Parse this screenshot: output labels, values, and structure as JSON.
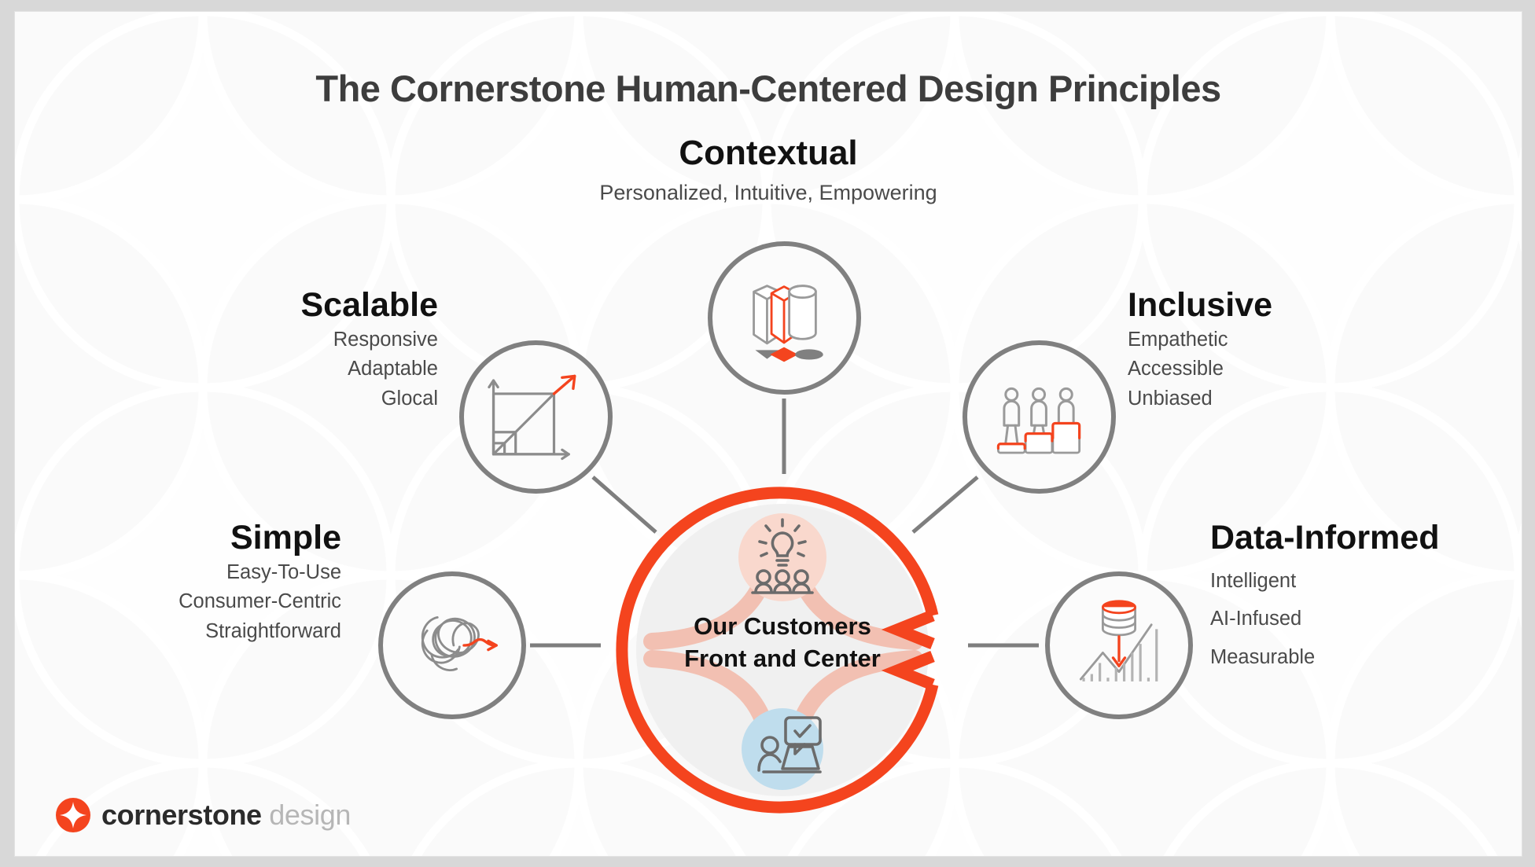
{
  "slide": {
    "title": "The Cornerstone Human-Centered Design Principles",
    "accent_color": "#f4441e",
    "circle_stroke_color": "#808080",
    "title_color": "#3d3d3d",
    "background_color": "#fafafa"
  },
  "center": {
    "line1": "Our Customers",
    "line2": "Front and Center",
    "ring_color": "#f4441e",
    "inner_color": "#f0f0f0",
    "top_icon": "lightbulb-people-icon",
    "bottom_icon": "person-laptop-check-icon",
    "connector_color": "#f2c0b2"
  },
  "principles": [
    {
      "id": "contextual",
      "heading": "Contextual",
      "attributes": [
        "Personalized, Intuitive, Empowering"
      ],
      "icon": "three-3d-shapes-icon",
      "position": "top"
    },
    {
      "id": "scalable",
      "heading": "Scalable",
      "attributes": [
        "Responsive",
        "Adaptable",
        "Glocal"
      ],
      "icon": "growth-arrow-squares-icon",
      "position": "upper-left"
    },
    {
      "id": "inclusive",
      "heading": "Inclusive",
      "attributes": [
        "Empathetic",
        "Accessible",
        "Unbiased"
      ],
      "icon": "equity-people-boxes-icon",
      "position": "upper-right"
    },
    {
      "id": "simple",
      "heading": "Simple",
      "attributes": [
        "Easy-To-Use",
        "Consumer-Centric",
        "Straightforward"
      ],
      "icon": "tangle-to-arrow-icon",
      "position": "lower-left"
    },
    {
      "id": "data-informed",
      "heading": "Data-Informed",
      "attributes": [
        "Intelligent",
        "AI-Infused",
        "Measurable"
      ],
      "icon": "database-chart-arrow-icon",
      "position": "lower-right"
    }
  ],
  "logo": {
    "mark": "cornerstone-star-mark-icon",
    "word_strong": "cornerstone",
    "word_light": "design",
    "mark_color": "#f4441e"
  }
}
